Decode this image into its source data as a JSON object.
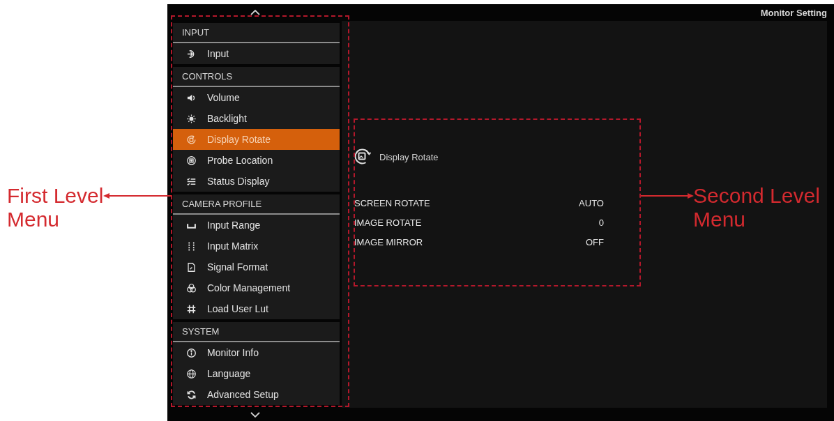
{
  "window": {
    "title": "Monitor Setting"
  },
  "menu": {
    "callout": "First Level Menu",
    "groups": [
      {
        "title": "INPUT",
        "items": [
          {
            "label": "Input",
            "selected": false
          }
        ]
      },
      {
        "title": "CONTROLS",
        "items": [
          {
            "label": "Volume",
            "selected": false
          },
          {
            "label": "Backlight",
            "selected": false
          },
          {
            "label": "Display Rotate",
            "selected": true
          },
          {
            "label": "Probe Location",
            "selected": false
          },
          {
            "label": "Status Display",
            "selected": false
          }
        ]
      },
      {
        "title": "CAMERA PROFILE",
        "items": [
          {
            "label": "Input Range",
            "selected": false
          },
          {
            "label": "Input Matrix",
            "selected": false
          },
          {
            "label": "Signal Format",
            "selected": false
          },
          {
            "label": "Color Management",
            "selected": false
          },
          {
            "label": "Load User Lut",
            "selected": false
          }
        ]
      },
      {
        "title": "SYSTEM",
        "items": [
          {
            "label": "Monitor Info",
            "selected": false
          },
          {
            "label": "Language",
            "selected": false
          },
          {
            "label": "Advanced Setup",
            "selected": false
          }
        ]
      }
    ]
  },
  "detail": {
    "callout": "Second Level Menu",
    "title": "Display Rotate",
    "rows": [
      {
        "label": "SCREEN ROTATE",
        "value": "AUTO"
      },
      {
        "label": "IMAGE ROTATE",
        "value": "0"
      },
      {
        "label": "IMAGE MIRROR",
        "value": "OFF"
      }
    ]
  }
}
